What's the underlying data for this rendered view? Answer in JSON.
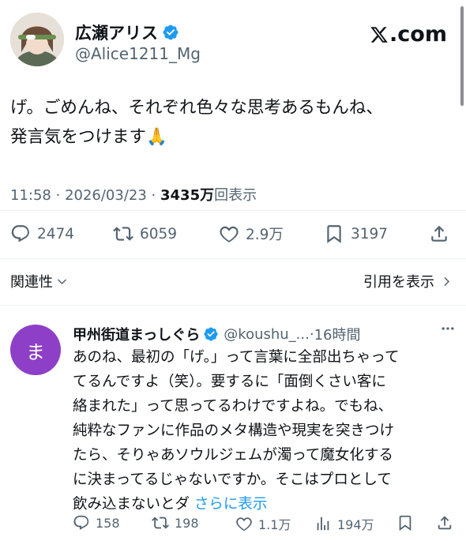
{
  "author": {
    "display_name": "広瀬アリス",
    "handle": "@Alice1211_Mg"
  },
  "brand": {
    "text": ".com",
    "logo_icon": "x-logo-icon"
  },
  "tweet": {
    "line1": "げ。ごめんね、それぞれ色々な思考あるもんね、",
    "line2": "発言気をつけます",
    "emoji": "🙏",
    "time": "11:58",
    "date": "2026/03/23",
    "views_count": "3435万",
    "views_label": "回表示"
  },
  "stats": {
    "replies": "2474",
    "retweets": "6059",
    "likes": "2.9万",
    "bookmarks": "3197"
  },
  "links": {
    "related": "関連性",
    "quotes": "引用を表示"
  },
  "reply": {
    "avatar_letter": "ま",
    "display_name": "甲州街道まっしぐら",
    "handle": "@koushu_...",
    "time": "16時間",
    "lines": [
      "あのね、最初の「げ。」って言葉に全部出ちゃって",
      "てるんですよ（笑）。要するに「面倒くさい客に",
      "絡まれた」って思ってるわけですよね。でもね、",
      "純粋なファンに作品のメタ構造や現実を突きつけ",
      "たら、そりゃあソウルジェムが濁って魔女化する",
      "に決まってるじゃないですか。そこはプロとして"
    ],
    "last_line": "飲み込まないとダ",
    "show_more": "さらに表示",
    "replies": "158",
    "retweets": "198",
    "likes": "1.1万",
    "views": "194万"
  },
  "colors": {
    "accent": "#1d9bf0",
    "reply_avatar_bg": "#8e3fc7",
    "secondary_text": "#536471"
  }
}
